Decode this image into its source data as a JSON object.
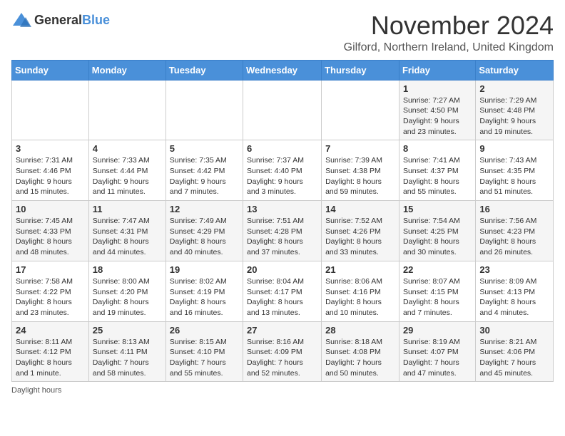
{
  "header": {
    "logo_general": "General",
    "logo_blue": "Blue",
    "month_year": "November 2024",
    "location": "Gilford, Northern Ireland, United Kingdom"
  },
  "calendar": {
    "days_of_week": [
      "Sunday",
      "Monday",
      "Tuesday",
      "Wednesday",
      "Thursday",
      "Friday",
      "Saturday"
    ],
    "weeks": [
      [
        {
          "day": "",
          "info": ""
        },
        {
          "day": "",
          "info": ""
        },
        {
          "day": "",
          "info": ""
        },
        {
          "day": "",
          "info": ""
        },
        {
          "day": "",
          "info": ""
        },
        {
          "day": "1",
          "info": "Sunrise: 7:27 AM\nSunset: 4:50 PM\nDaylight: 9 hours and 23 minutes."
        },
        {
          "day": "2",
          "info": "Sunrise: 7:29 AM\nSunset: 4:48 PM\nDaylight: 9 hours and 19 minutes."
        }
      ],
      [
        {
          "day": "3",
          "info": "Sunrise: 7:31 AM\nSunset: 4:46 PM\nDaylight: 9 hours and 15 minutes."
        },
        {
          "day": "4",
          "info": "Sunrise: 7:33 AM\nSunset: 4:44 PM\nDaylight: 9 hours and 11 minutes."
        },
        {
          "day": "5",
          "info": "Sunrise: 7:35 AM\nSunset: 4:42 PM\nDaylight: 9 hours and 7 minutes."
        },
        {
          "day": "6",
          "info": "Sunrise: 7:37 AM\nSunset: 4:40 PM\nDaylight: 9 hours and 3 minutes."
        },
        {
          "day": "7",
          "info": "Sunrise: 7:39 AM\nSunset: 4:38 PM\nDaylight: 8 hours and 59 minutes."
        },
        {
          "day": "8",
          "info": "Sunrise: 7:41 AM\nSunset: 4:37 PM\nDaylight: 8 hours and 55 minutes."
        },
        {
          "day": "9",
          "info": "Sunrise: 7:43 AM\nSunset: 4:35 PM\nDaylight: 8 hours and 51 minutes."
        }
      ],
      [
        {
          "day": "10",
          "info": "Sunrise: 7:45 AM\nSunset: 4:33 PM\nDaylight: 8 hours and 48 minutes."
        },
        {
          "day": "11",
          "info": "Sunrise: 7:47 AM\nSunset: 4:31 PM\nDaylight: 8 hours and 44 minutes."
        },
        {
          "day": "12",
          "info": "Sunrise: 7:49 AM\nSunset: 4:29 PM\nDaylight: 8 hours and 40 minutes."
        },
        {
          "day": "13",
          "info": "Sunrise: 7:51 AM\nSunset: 4:28 PM\nDaylight: 8 hours and 37 minutes."
        },
        {
          "day": "14",
          "info": "Sunrise: 7:52 AM\nSunset: 4:26 PM\nDaylight: 8 hours and 33 minutes."
        },
        {
          "day": "15",
          "info": "Sunrise: 7:54 AM\nSunset: 4:25 PM\nDaylight: 8 hours and 30 minutes."
        },
        {
          "day": "16",
          "info": "Sunrise: 7:56 AM\nSunset: 4:23 PM\nDaylight: 8 hours and 26 minutes."
        }
      ],
      [
        {
          "day": "17",
          "info": "Sunrise: 7:58 AM\nSunset: 4:22 PM\nDaylight: 8 hours and 23 minutes."
        },
        {
          "day": "18",
          "info": "Sunrise: 8:00 AM\nSunset: 4:20 PM\nDaylight: 8 hours and 19 minutes."
        },
        {
          "day": "19",
          "info": "Sunrise: 8:02 AM\nSunset: 4:19 PM\nDaylight: 8 hours and 16 minutes."
        },
        {
          "day": "20",
          "info": "Sunrise: 8:04 AM\nSunset: 4:17 PM\nDaylight: 8 hours and 13 minutes."
        },
        {
          "day": "21",
          "info": "Sunrise: 8:06 AM\nSunset: 4:16 PM\nDaylight: 8 hours and 10 minutes."
        },
        {
          "day": "22",
          "info": "Sunrise: 8:07 AM\nSunset: 4:15 PM\nDaylight: 8 hours and 7 minutes."
        },
        {
          "day": "23",
          "info": "Sunrise: 8:09 AM\nSunset: 4:13 PM\nDaylight: 8 hours and 4 minutes."
        }
      ],
      [
        {
          "day": "24",
          "info": "Sunrise: 8:11 AM\nSunset: 4:12 PM\nDaylight: 8 hours and 1 minute."
        },
        {
          "day": "25",
          "info": "Sunrise: 8:13 AM\nSunset: 4:11 PM\nDaylight: 7 hours and 58 minutes."
        },
        {
          "day": "26",
          "info": "Sunrise: 8:15 AM\nSunset: 4:10 PM\nDaylight: 7 hours and 55 minutes."
        },
        {
          "day": "27",
          "info": "Sunrise: 8:16 AM\nSunset: 4:09 PM\nDaylight: 7 hours and 52 minutes."
        },
        {
          "day": "28",
          "info": "Sunrise: 8:18 AM\nSunset: 4:08 PM\nDaylight: 7 hours and 50 minutes."
        },
        {
          "day": "29",
          "info": "Sunrise: 8:19 AM\nSunset: 4:07 PM\nDaylight: 7 hours and 47 minutes."
        },
        {
          "day": "30",
          "info": "Sunrise: 8:21 AM\nSunset: 4:06 PM\nDaylight: 7 hours and 45 minutes."
        }
      ]
    ]
  },
  "footer": {
    "daylight_hours_label": "Daylight hours"
  }
}
